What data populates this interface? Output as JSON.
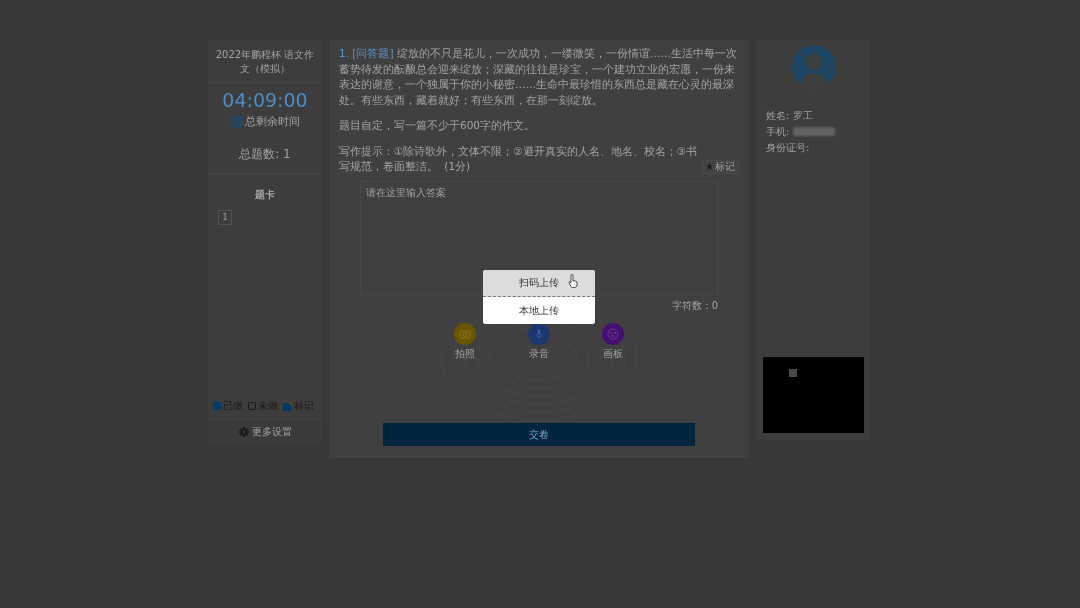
{
  "exam_info": {
    "title": "2022年鹏程杯 语文作文（模拟）",
    "timer": "04:09:00",
    "timer_label": "总剩余时间",
    "total_questions": "总题数: 1"
  },
  "answer_card": {
    "title": "题卡",
    "items": [
      {
        "label": "1",
        "selected": false
      }
    ]
  },
  "legend": [
    {
      "label": "已做",
      "kind": "done"
    },
    {
      "label": "未做",
      "kind": "todo"
    },
    {
      "label": "标记",
      "kind": "marked"
    }
  ],
  "more_settings": "更多设置",
  "question": {
    "number": "1.",
    "type": "[问答题]",
    "text": "绽放的不只是花儿，一次成功，一缕微笑，一份情谊……生活中每一次蓄势待发的酝酿总会迎来绽放；深藏的往往是珍宝，一个建功立业的宏愿，一份未表达的谢意，一个独属于你的小秘密……生命中最珍惜的东西总是藏在心灵的最深处。有些东西，藏着就好；有些东西，在那一刻绽放。",
    "prompt": "题目自定，写一篇不少于600字的作文。",
    "tips": "写作提示：①除诗歌外，文体不限；②避开真实的人名、地名、校名；③书写规范，卷面整洁。",
    "score": "(1分)",
    "mark_button": "标记"
  },
  "answer": {
    "placeholder": "请在这里输入答案",
    "char_count": "字符数：0"
  },
  "tools": [
    {
      "label": "拍照",
      "kind": "camera",
      "color": "#6b5600"
    },
    {
      "label": "录音",
      "kind": "microphone",
      "color": "#1c3670"
    },
    {
      "label": "画板",
      "kind": "palette",
      "color": "#470e72"
    }
  ],
  "upload_menu": [
    {
      "label": "扫码上传",
      "selected": true
    },
    {
      "label": "本地上传",
      "selected": false
    }
  ],
  "submit": "交卷",
  "profile": {
    "fields": [
      {
        "label": "姓名:",
        "value": "罗工"
      },
      {
        "label": "手机:",
        "redacted": true
      },
      {
        "label": "身份证号:"
      }
    ]
  }
}
